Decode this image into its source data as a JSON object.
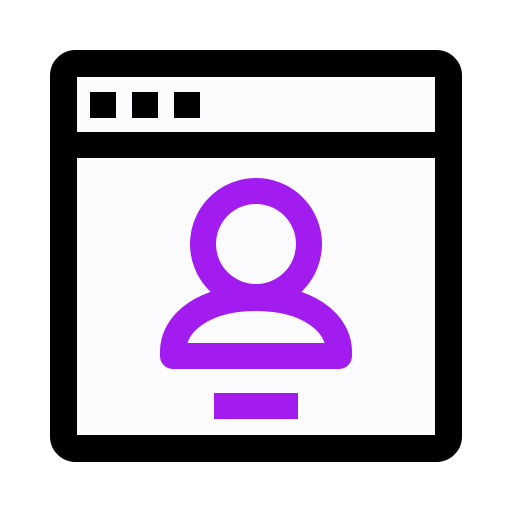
{
  "icon": {
    "name": "browser-user-profile-icon",
    "window": {
      "name": "browser-window-icon",
      "stroke_color": "#000000",
      "fill_color": "#fcfbfd",
      "controls": {
        "name": "window-controls-icon",
        "count": 3,
        "color": "#000000"
      }
    },
    "user": {
      "name": "user-avatar-icon",
      "color": "#a21cf0"
    },
    "underline": {
      "name": "user-underline-bar",
      "color": "#a21cf0"
    }
  }
}
